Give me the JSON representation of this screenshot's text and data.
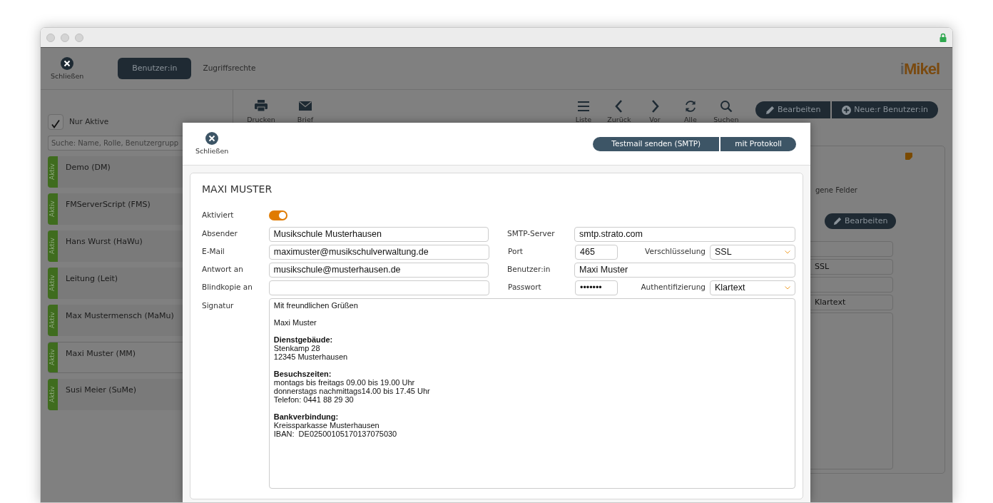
{
  "toolbar": {
    "close_label": "Schließen",
    "tabs": [
      {
        "label": "Benutzer:in",
        "selected": true
      },
      {
        "label": "Zugriffsrechte",
        "selected": false
      }
    ],
    "logo": {
      "prefix": "i",
      "name": "Mikel"
    }
  },
  "sidebar": {
    "filter": {
      "label": "Nur Aktive",
      "checked": true
    },
    "search": {
      "placeholder": "Suche: Name, Rolle, Benutzergrupp"
    },
    "users": [
      {
        "name": "Demo (DM)",
        "status": "Aktiv",
        "selected": false
      },
      {
        "name": "FMServerScript (FMS)",
        "status": "Aktiv",
        "selected": false
      },
      {
        "name": "Hans Wurst (HaWu)",
        "status": "Aktiv",
        "selected": false
      },
      {
        "name": "Leitung (Leit)",
        "status": "Aktiv",
        "selected": false
      },
      {
        "name": "Max Mustermensch (MaMu)",
        "status": "Aktiv",
        "selected": false
      },
      {
        "name": "Maxi Muster (MM)",
        "status": "Aktiv",
        "selected": true
      },
      {
        "name": "Susi Meier (SuMe)",
        "status": "Aktiv",
        "selected": false
      }
    ]
  },
  "main": {
    "left_actions": [
      "Drucken",
      "Brief"
    ],
    "right_actions": [
      "Liste",
      "Zurück",
      "Vor",
      "Alle",
      "Suchen"
    ],
    "buttons": [
      "Bearbeiten",
      "Neue:r Benutzer:in"
    ],
    "panel": {
      "caption": "gene Felder",
      "edit_label": "Bearbeiten",
      "fields": [
        {
          "kind": "input"
        },
        {
          "kind": "input",
          "value": "SSL"
        },
        {
          "kind": "input"
        },
        {
          "kind": "input",
          "value": "Klartext"
        },
        {
          "kind": "area"
        }
      ]
    }
  },
  "dialog": {
    "close_label": "Schließen",
    "buttons": [
      "Testmail senden (SMTP)",
      "mit Protokoll"
    ],
    "title": "MAXI MUSTER",
    "active": {
      "label": "Aktiviert",
      "on": true
    },
    "rows": [
      {
        "label": "Absender",
        "value": "Musikschule Musterhausen",
        "right": [
          {
            "label": "SMTP-Server",
            "value": "smtp.strato.com",
            "kind": "input"
          }
        ]
      },
      {
        "label": "E-Mail",
        "value": "maximuster@musikschulverwaltung.de",
        "right": [
          {
            "label": "Port",
            "value": "465",
            "kind": "short"
          },
          {
            "label": "Verschlüsselung",
            "value": "SSL",
            "kind": "select"
          }
        ]
      },
      {
        "label": "Antwort an",
        "value": "musikschule@musterhausen.de",
        "right": [
          {
            "label": "Benutzer:in",
            "value": "Maxi Muster",
            "kind": "input"
          }
        ]
      },
      {
        "label": "Blindkopie an",
        "right": [
          {
            "label": "Passwort",
            "value": "•••••••",
            "kind": "short"
          },
          {
            "label": "Authentifizierung",
            "value": "Klartext",
            "kind": "select"
          }
        ]
      }
    ],
    "signature": {
      "label": "Signatur",
      "paragraphs": [
        {
          "lines": [
            {
              "text": "Mit freundlichen Grüßen",
              "bold": false
            }
          ]
        },
        {
          "lines": [
            {
              "text": "Maxi Muster",
              "bold": false
            }
          ]
        },
        {
          "lines": [
            {
              "text": "Dienstgebäude:",
              "bold": true
            },
            {
              "text": "Stenkamp 28",
              "bold": false
            },
            {
              "text": "12345 Musterhausen",
              "bold": false
            }
          ]
        },
        {
          "lines": [
            {
              "text": "Besuchszeiten:",
              "bold": true
            },
            {
              "text": "montags bis freitags 09.00 bis 19.00 Uhr",
              "bold": false
            },
            {
              "text": "donnerstags nachmittags14.00 bis 17.45 Uhr",
              "bold": false
            },
            {
              "text": "Telefon: 0441 88 29 30",
              "bold": false
            }
          ]
        },
        {
          "lines": [
            {
              "text": "Bankverbindung:",
              "bold": true
            },
            {
              "text": "Kreissparkasse Musterhausen",
              "bold": false
            },
            {
              "text": "IBAN:  DE02500105170137075030",
              "bold": false
            }
          ]
        }
      ]
    }
  }
}
